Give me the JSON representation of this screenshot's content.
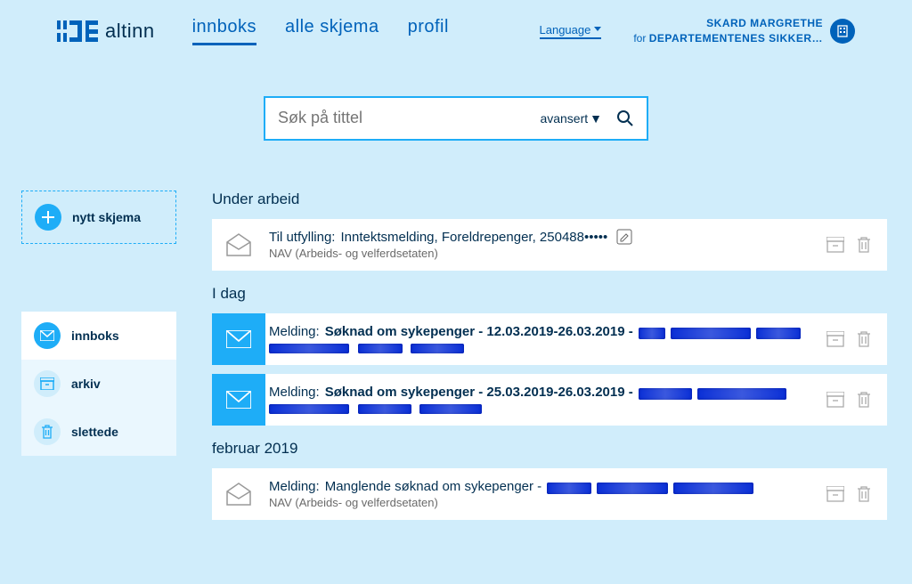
{
  "header": {
    "brand": "altinn",
    "nav": [
      {
        "label": "innboks",
        "active": true
      },
      {
        "label": "alle skjema",
        "active": false
      },
      {
        "label": "profil",
        "active": false
      }
    ],
    "language_label": "Language",
    "user": {
      "name": "SKARD MARGRETHE",
      "for_prefix": "for",
      "org": "DEPARTEMENTENES SIKKER…"
    }
  },
  "search": {
    "placeholder": "Søk på tittel",
    "advanced_label": "avansert"
  },
  "sidebar": {
    "new_form": "nytt skjema",
    "folders": [
      {
        "label": "innboks",
        "icon": "mail",
        "active": true
      },
      {
        "label": "arkiv",
        "icon": "archive",
        "active": false
      },
      {
        "label": "slettede",
        "icon": "trash",
        "active": false
      }
    ]
  },
  "sections": [
    {
      "title": "Under arbeid",
      "items": [
        {
          "icon_style": "open",
          "prefix": "Til utfylling:",
          "bold": "",
          "rest": "Inntektsmelding, Foreldrepenger, 250488•••••",
          "editable": true,
          "sub": "NAV (Arbeids- og velferdsetaten)",
          "redacted_title": false,
          "redacted_sub": false
        }
      ]
    },
    {
      "title": "I dag",
      "items": [
        {
          "icon_style": "blue",
          "prefix": "Melding:",
          "bold": "Søknad om sykepenger - 12.03.2019-26.03.2019 -",
          "rest": "",
          "editable": false,
          "sub": "",
          "redacted_title": true,
          "redacted_sub": true
        },
        {
          "icon_style": "blue",
          "prefix": "Melding:",
          "bold": "Søknad om sykepenger - 25.03.2019-26.03.2019 -",
          "rest": "",
          "editable": false,
          "sub": "",
          "redacted_title": true,
          "redacted_sub": true
        }
      ]
    },
    {
      "title": "februar 2019",
      "items": [
        {
          "icon_style": "open",
          "prefix": "Melding:",
          "bold": "",
          "rest": "Manglende søknad om sykepenger -",
          "editable": false,
          "sub": "NAV (Arbeids- og velferdsetaten)",
          "redacted_title": true,
          "redacted_sub": false
        }
      ]
    }
  ]
}
